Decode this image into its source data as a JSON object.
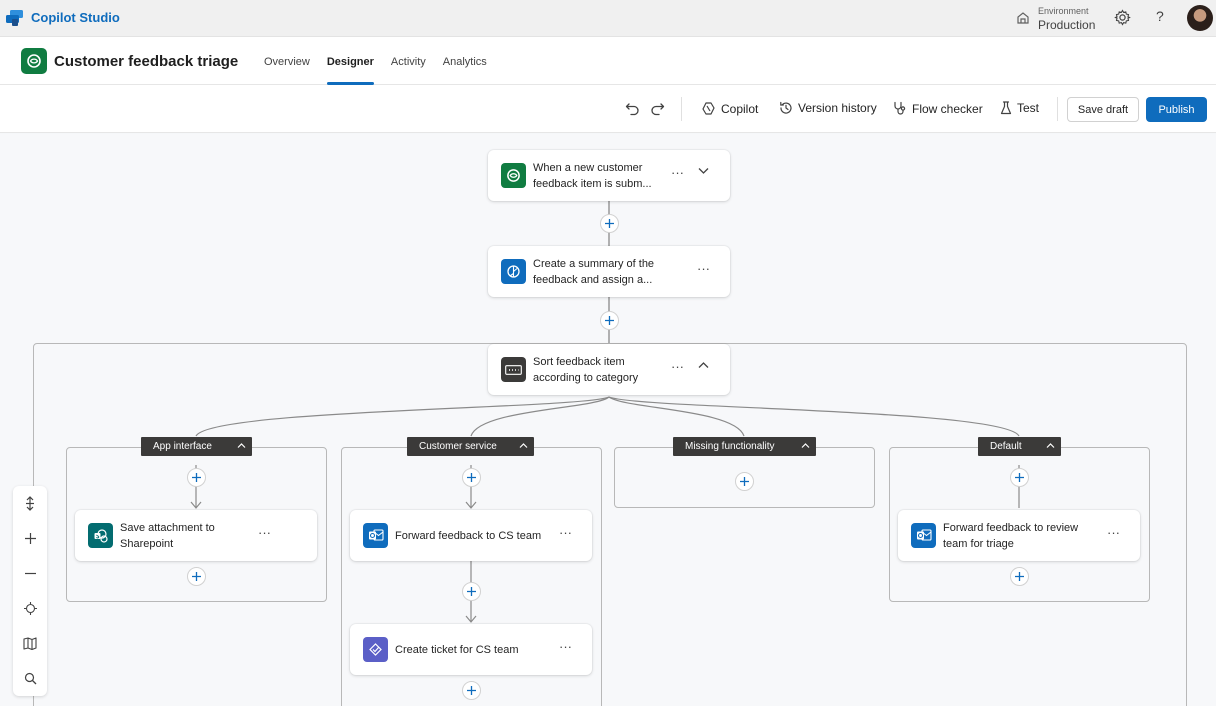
{
  "app": {
    "name": "Copilot Studio"
  },
  "environment": {
    "label": "Environment",
    "value": "Production"
  },
  "help_glyph": "?",
  "agent": {
    "title": "Customer feedback triage"
  },
  "tabs": [
    {
      "label": "Overview"
    },
    {
      "label": "Designer",
      "active": true
    },
    {
      "label": "Activity"
    },
    {
      "label": "Analytics"
    }
  ],
  "toolbar": {
    "copilot": "Copilot",
    "version_history": "Version history",
    "flow_checker": "Flow checker",
    "test": "Test",
    "save_draft": "Save draft",
    "publish": "Publish"
  },
  "flow": {
    "trigger": {
      "text": "When a new customer feedback item is subm..."
    },
    "summary": {
      "text": "Create a summary of the feedback and assign a..."
    },
    "switch": {
      "text": "Sort feedback item according to category"
    },
    "branches": [
      {
        "label": "App interface",
        "action": "Save attachment to Sharepoint"
      },
      {
        "label": "Customer service",
        "action": "Forward feedback to CS team",
        "action2": "Create ticket for CS team"
      },
      {
        "label": "Missing functionality"
      },
      {
        "label": "Default",
        "action": "Forward feedback to review team for triage"
      }
    ]
  },
  "more_glyph": "···",
  "colors": {
    "brand_blue": "#0f6cbd",
    "agent_green": "#107c41",
    "summary_blue": "#0f6cbd",
    "switch_gray": "#3b3a39",
    "sharepoint_teal": "#036c70",
    "outlook_blue": "#0f6cbd",
    "planner_purple": "#5b5fc7"
  }
}
